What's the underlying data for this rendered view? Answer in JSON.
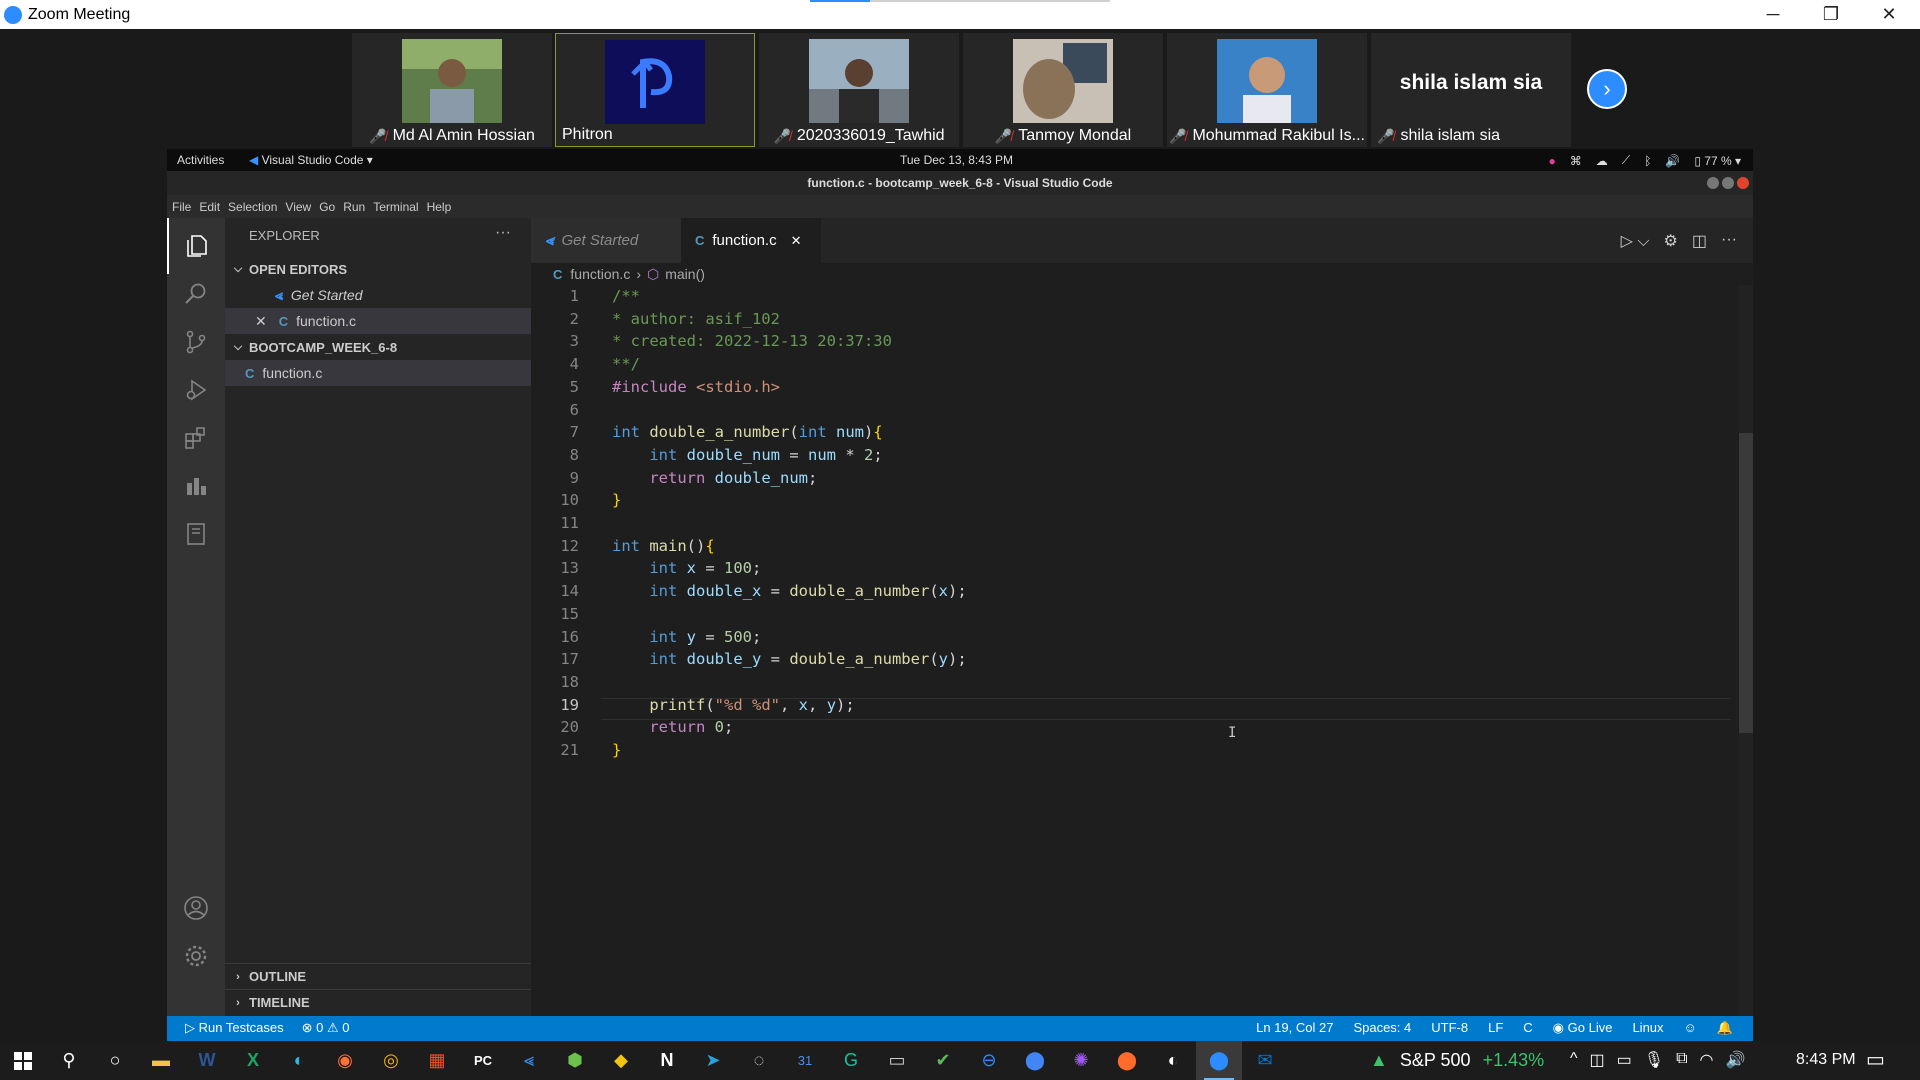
{
  "window": {
    "title": "Zoom Meeting",
    "minimize": "─",
    "restore": "❐",
    "close": "✕"
  },
  "participants": [
    {
      "name": "Md Al Amin Hossian",
      "muted": true
    },
    {
      "name": "Phitron",
      "muted": false
    },
    {
      "name": "2020336019_Tawhid",
      "muted": true
    },
    {
      "name": "Tanmoy Mondal",
      "muted": true
    },
    {
      "name": "Mohummad Rakibul Is...",
      "muted": true
    },
    {
      "name": "shila islam sia",
      "muted": true,
      "display_text": "shila islam sia"
    }
  ],
  "gnome": {
    "activities": "Activities",
    "app": "Visual Studio Code ▾",
    "clock": "Tue Dec 13,  8:43 PM",
    "battery": "77 %"
  },
  "vscode": {
    "window_title": "function.c - bootcamp_week_6-8 - Visual Studio Code",
    "menu": [
      "File",
      "Edit",
      "Selection",
      "View",
      "Go",
      "Run",
      "Terminal",
      "Help"
    ],
    "explorer": {
      "header": "EXPLORER",
      "open_editors": "OPEN EDITORS",
      "open_items": [
        "Get Started",
        "function.c"
      ],
      "folder": "BOOTCAMP_WEEK_6-8",
      "files": [
        "function.c"
      ],
      "outline": "OUTLINE",
      "timeline": "TIMELINE"
    },
    "tabs": [
      {
        "label": "Get Started",
        "active": false
      },
      {
        "label": "function.c",
        "active": true
      }
    ],
    "breadcrumb": {
      "file": "function.c",
      "symbol": "main()"
    },
    "code_lines": [
      "/**",
      "* author: asif_102",
      "* created: 2022-12-13 20:37:30",
      "**/",
      "#include <stdio.h>",
      "",
      "int double_a_number(int num){",
      "    int double_num = num * 2;",
      "    return double_num;",
      "}",
      "",
      "int main(){",
      "    int x = 100;",
      "    int double_x = double_a_number(x);",
      "",
      "    int y = 500;",
      "    int double_y = double_a_number(y);",
      "",
      "    printf(\"%d %d\", x, y);",
      "    return 0;",
      "}"
    ],
    "current_line": 19,
    "status": {
      "run_testcases": "Run Testcases",
      "problems": "⊗ 0 ⚠ 0",
      "position": "Ln 19, Col 27",
      "spaces": "Spaces: 4",
      "encoding": "UTF-8",
      "eol": "LF",
      "language": "C",
      "golive": "Go Live",
      "os": "Linux"
    }
  },
  "taskbar": {
    "stock": "S&P 500",
    "change": "+1.43%",
    "time": "8:43 PM"
  },
  "colors": {
    "accent": "#007acc",
    "zoom_blue": "#2d8cff",
    "editor_bg": "#1e1e1e"
  }
}
